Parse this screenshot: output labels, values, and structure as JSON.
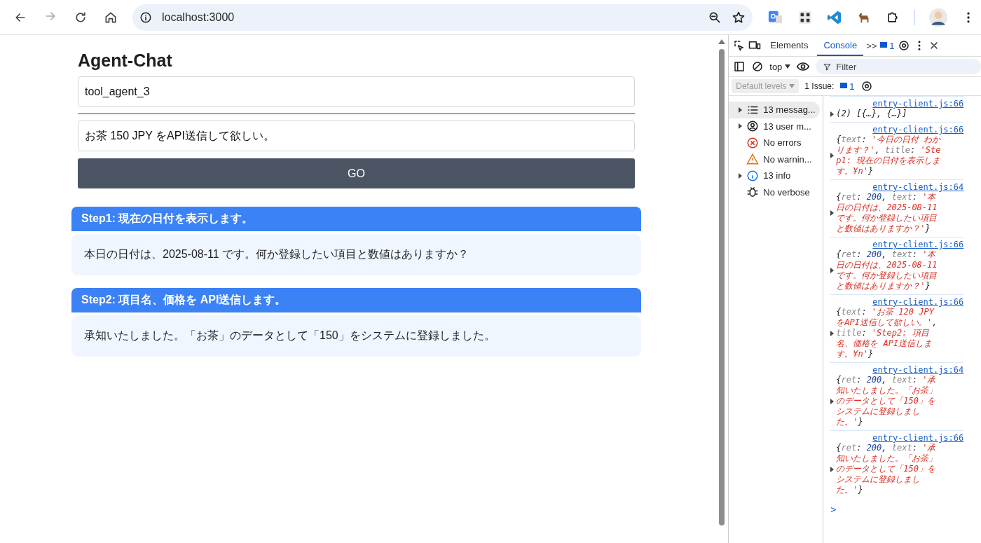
{
  "browser": {
    "url": "localhost:3000"
  },
  "page": {
    "title": "Agent-Chat",
    "agent_name": {
      "value": "tool_agent_3"
    },
    "message": {
      "value": "お茶 150 JPY をAPI送信して欲しい。"
    },
    "go_button": "GO",
    "steps": [
      {
        "title": "Step1: 現在の日付を表示します。",
        "text": "本日の日付は、2025-08-11 です。何か登録したい項目と数値はありますか？"
      },
      {
        "title": "Step2: 項目名、価格を API送信します。",
        "text": "承知いたしました。「お茶」のデータとして「150」をシステムに登録しました。"
      }
    ]
  },
  "devtools": {
    "tabs": [
      {
        "label": "Elements",
        "selected": false
      },
      {
        "label": "Console",
        "selected": true
      }
    ],
    "more": ">>",
    "issues_badge": "1",
    "context": "top",
    "filter": {
      "placeholder": "Filter"
    },
    "levels": "Default levels",
    "issues": {
      "label": "1 Issue:",
      "count": "1"
    },
    "sidebar": [
      {
        "kind": "messages",
        "label": "13 messag...",
        "expandable": true,
        "selected": true
      },
      {
        "kind": "user",
        "label": "13 user m...",
        "expandable": true,
        "selected": false
      },
      {
        "kind": "errors",
        "label": "No errors",
        "expandable": false,
        "selected": false
      },
      {
        "kind": "warnings",
        "label": "No warnin...",
        "expandable": false,
        "selected": false
      },
      {
        "kind": "info",
        "label": "13 info",
        "expandable": true,
        "selected": false
      },
      {
        "kind": "verbose",
        "label": "No verbose",
        "expandable": false,
        "selected": false
      }
    ],
    "console": [
      {
        "source": "entry-client.js:66",
        "tokens": [
          {
            "kind": "p",
            "text": "(2) [{…}, {…}]"
          }
        ]
      },
      {
        "source": "entry-client.js:66",
        "tokens": [
          {
            "kind": "p",
            "text": "{"
          },
          {
            "kind": "k",
            "text": "text"
          },
          {
            "kind": "p",
            "text": ": "
          },
          {
            "kind": "s",
            "text": "'今日の日付 わかります？'"
          },
          {
            "kind": "p",
            "text": ", "
          },
          {
            "kind": "k",
            "text": "title"
          },
          {
            "kind": "p",
            "text": ": "
          },
          {
            "kind": "s",
            "text": "'Step1: 現在の日付を表示します。¥n'"
          },
          {
            "kind": "p",
            "text": "}"
          }
        ]
      },
      {
        "source": "entry-client.js:64",
        "tokens": [
          {
            "kind": "p",
            "text": "{"
          },
          {
            "kind": "k",
            "text": "ret"
          },
          {
            "kind": "p",
            "text": ": "
          },
          {
            "kind": "n",
            "text": "200"
          },
          {
            "kind": "p",
            "text": ", "
          },
          {
            "kind": "k",
            "text": "text"
          },
          {
            "kind": "p",
            "text": ": "
          },
          {
            "kind": "s",
            "text": "'本日の日付は、2025-08-11 です。何か登録したい項目と数値はありますか？'"
          },
          {
            "kind": "p",
            "text": "}"
          }
        ]
      },
      {
        "source": "entry-client.js:66",
        "tokens": [
          {
            "kind": "p",
            "text": "{"
          },
          {
            "kind": "k",
            "text": "ret"
          },
          {
            "kind": "p",
            "text": ": "
          },
          {
            "kind": "n",
            "text": "200"
          },
          {
            "kind": "p",
            "text": ", "
          },
          {
            "kind": "k",
            "text": "text"
          },
          {
            "kind": "p",
            "text": ": "
          },
          {
            "kind": "s",
            "text": "'本日の日付は、2025-08-11 です。何か登録したい項目と数値はありますか？'"
          },
          {
            "kind": "p",
            "text": "}"
          }
        ]
      },
      {
        "source": "entry-client.js:66",
        "tokens": [
          {
            "kind": "p",
            "text": "{"
          },
          {
            "kind": "k",
            "text": "text"
          },
          {
            "kind": "p",
            "text": ": "
          },
          {
            "kind": "s",
            "text": "'お茶 120 JPY をAPI送信して欲しい。'"
          },
          {
            "kind": "p",
            "text": ", "
          },
          {
            "kind": "k",
            "text": "title"
          },
          {
            "kind": "p",
            "text": ": "
          },
          {
            "kind": "s",
            "text": "'Step2: 項目名、価格を API送信します。¥n'"
          },
          {
            "kind": "p",
            "text": "}"
          }
        ]
      },
      {
        "source": "entry-client.js:64",
        "tokens": [
          {
            "kind": "p",
            "text": "{"
          },
          {
            "kind": "k",
            "text": "ret"
          },
          {
            "kind": "p",
            "text": ": "
          },
          {
            "kind": "n",
            "text": "200"
          },
          {
            "kind": "p",
            "text": ", "
          },
          {
            "kind": "k",
            "text": "text"
          },
          {
            "kind": "p",
            "text": ": "
          },
          {
            "kind": "s",
            "text": "'承知いたしました。「お茶」のデータとして「150」をシステムに登録しました。'"
          },
          {
            "kind": "p",
            "text": "}"
          }
        ]
      },
      {
        "source": "entry-client.js:66",
        "tokens": [
          {
            "kind": "p",
            "text": "{"
          },
          {
            "kind": "k",
            "text": "ret"
          },
          {
            "kind": "p",
            "text": ": "
          },
          {
            "kind": "n",
            "text": "200"
          },
          {
            "kind": "p",
            "text": ", "
          },
          {
            "kind": "k",
            "text": "text"
          },
          {
            "kind": "p",
            "text": ": "
          },
          {
            "kind": "s",
            "text": "'承知いたしました。「お茶」のデータとして「150」をシステムに登録しました。'"
          },
          {
            "kind": "p",
            "text": "}"
          }
        ]
      }
    ],
    "prompt": ">"
  }
}
